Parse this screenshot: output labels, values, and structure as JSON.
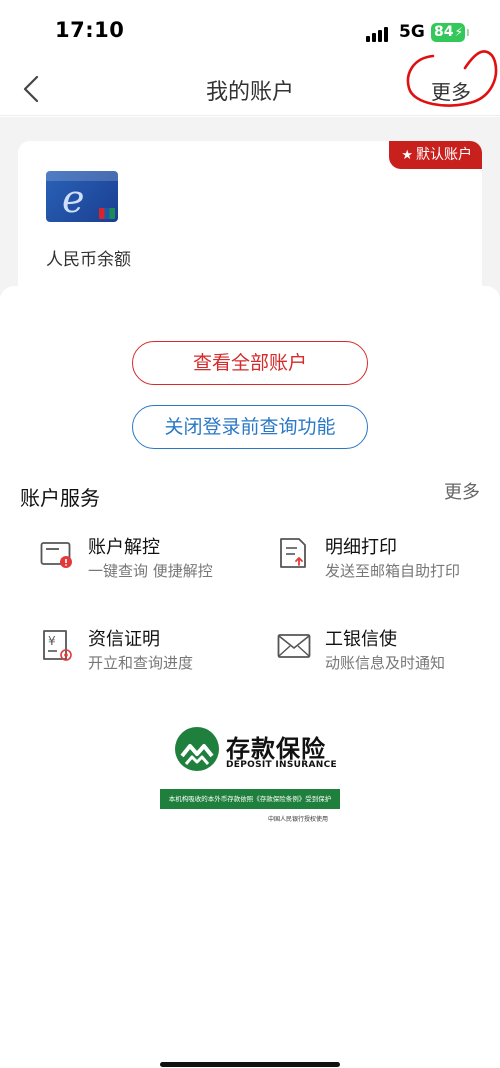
{
  "status_bar": {
    "time": "17:10",
    "network": "5G",
    "battery": "84"
  },
  "nav": {
    "title": "我的账户",
    "more": "更多"
  },
  "card": {
    "default_badge": "默认账户",
    "balance_label": "人民币余额"
  },
  "buttons": {
    "view_all": "查看全部账户",
    "disable_query": "关闭登录前查询功能"
  },
  "services": {
    "title": "账户服务",
    "more": "更多",
    "items": [
      {
        "title": "账户解控",
        "subtitle": "一键查询 便捷解控",
        "icon": "account-unlock-icon"
      },
      {
        "title": "明细打印",
        "subtitle": "发送至邮箱自助打印",
        "icon": "print-detail-icon"
      },
      {
        "title": "资信证明",
        "subtitle": "开立和查询进度",
        "icon": "credit-certificate-icon"
      },
      {
        "title": "工银信使",
        "subtitle": "动账信息及时通知",
        "icon": "envelope-icon"
      }
    ]
  },
  "insurance": {
    "title_cn": "存款保险",
    "title_en": "DEPOSIT INSURANCE",
    "bar_text": "本机构吸收的本外币存款依照《存款保险条例》受到保护",
    "note": "中国人民银行授权使用"
  },
  "colors": {
    "red": "#d52b2b",
    "blue": "#2a78c6",
    "green": "#1f7f3d",
    "annotation": "#e01010"
  }
}
